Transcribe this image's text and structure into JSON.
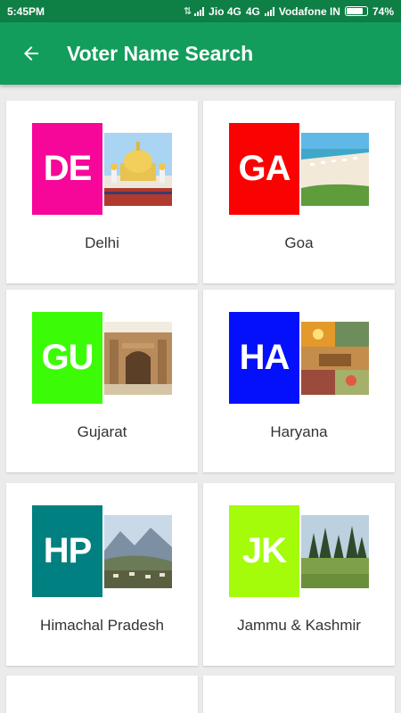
{
  "status_bar": {
    "time": "5:45PM",
    "carrier1": "Jio 4G",
    "network2": "4G",
    "carrier2": "Vodafone IN",
    "battery": "74%"
  },
  "app_bar": {
    "title": "Voter Name Search",
    "back_icon": "arrow-left-icon"
  },
  "states": [
    {
      "code": "DE",
      "name": "Delhi",
      "color": "#f7069a",
      "icon": "gurudwara-photo"
    },
    {
      "code": "GA",
      "name": "Goa",
      "color": "#fb0202",
      "icon": "beach-photo"
    },
    {
      "code": "GU",
      "name": "Gujarat",
      "color": "#3cfb06",
      "icon": "mosque-photo"
    },
    {
      "code": "HA",
      "name": "Haryana",
      "color": "#0410fb",
      "icon": "landscape-collage-photo"
    },
    {
      "code": "HP",
      "name": "Himachal Pradesh",
      "color": "#008080",
      "icon": "mountain-valley-photo"
    },
    {
      "code": "JK",
      "name": "Jammu & Kashmir",
      "color": "#a4fb0a",
      "icon": "forest-meadow-photo"
    }
  ]
}
